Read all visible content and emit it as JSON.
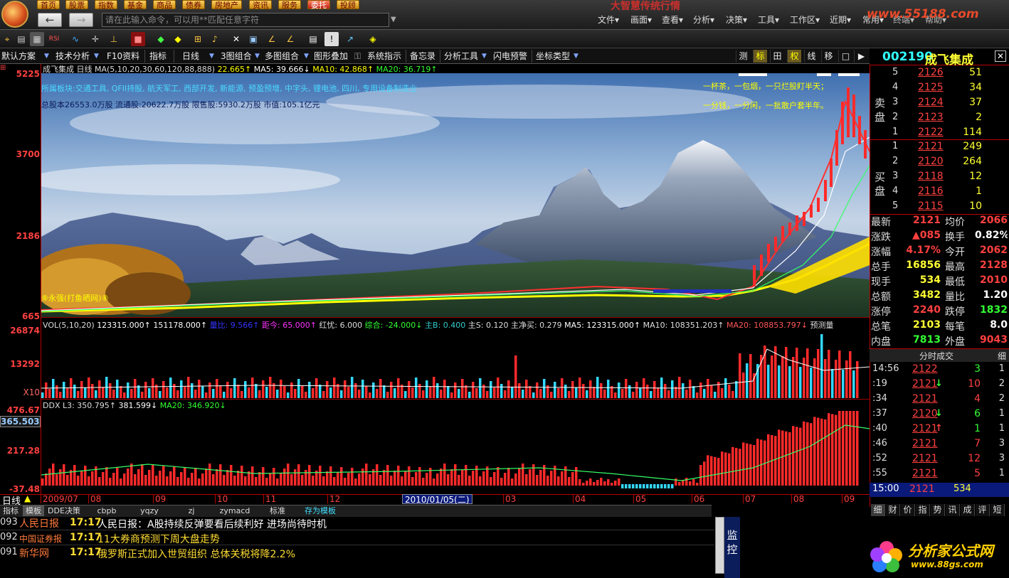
{
  "titlebar": {
    "markets": [
      "首页",
      "股票",
      "指数",
      "基金",
      "商品",
      "债券",
      "房地产",
      "资讯",
      "服务",
      "委托",
      "投顾"
    ],
    "back_icon": "←",
    "fwd_icon": "→",
    "command_placeholder": "请在此输入命令，可以用**匹配任意字符",
    "app_title": "大智慧传统行情",
    "menus": [
      "文件▾",
      "画面▾",
      "查看▾",
      "分析▾",
      "决策▾",
      "工具▾",
      "工作区▾",
      "近期▾",
      "常用▾",
      "终端▾",
      "帮助▾"
    ],
    "site_watermark": "www.55188.com"
  },
  "toolbar2": {
    "scheme": "默认方案",
    "items": [
      "技术分析",
      "F10资料",
      "指标",
      "日线",
      "3图组合",
      "多图组合",
      "图形叠加",
      "系统指示",
      "备忘录",
      "分析工具",
      "闪电预警",
      "坐标类型"
    ],
    "right": [
      "测",
      "标",
      "田",
      "权",
      "线",
      "移",
      "□",
      "▶"
    ]
  },
  "stock": {
    "code": "002190",
    "name": "成飞集成",
    "header_text": "成飞集成 日线",
    "ma_text": "MA(5,10,20,30,60,120,88,888)",
    "ma_value": "22.665↑",
    "ma5": "MA5: 39.666↓",
    "ma10": "MA10: 42.868↑",
    "ma20": "MA20: 36.719↑",
    "concepts": "所属板块:交通工具, QFII持股, 航天军工, 西部开发, 新能源, 预盈预增, 中字头, 锂电池, 四川, 专用设备制造业",
    "shares": "总股本26553.0万股 流通股:20622.7万股 限售股:5930.2万股 市值:105.1亿元",
    "poem1": "一杯茶，一包烟，一只烂股盯半天；",
    "poem2": "一分钱，一分闲，一批散户套半年。",
    "author": "⑧永强(打鱼晒网)⑧",
    "y_labels": [
      "5225",
      "3700",
      "2186",
      "665"
    ]
  },
  "volume": {
    "header": [
      "VOL(5,10,20)",
      "123315.000↑",
      "151178.000↑",
      "量比: 9.566↑",
      "距今: 65.000↑",
      "红忧: 6.000",
      "综合: -24.000↓",
      "主B: 0.400",
      "主S: 0.120",
      "主净买: 0.279",
      "MA5: 123315.000↑",
      "MA10: 108351.203↑",
      "MA20: 108853.797↓",
      "预测量"
    ],
    "y_labels": [
      "26874",
      "13292",
      "X10"
    ]
  },
  "ddx": {
    "header": [
      "DDX L3: 350.795↑",
      "381.599↓",
      "MA20: 346.920↓"
    ],
    "y_labels": [
      "476.67",
      "365.503",
      "217.28",
      "-37.48"
    ]
  },
  "xaxis": {
    "period": "日线",
    "labels": [
      "2009/07",
      "08",
      "09",
      "10",
      "11",
      "12",
      "2010/01/05(二)",
      "03",
      "04",
      "05",
      "06",
      "07",
      "08",
      "09"
    ]
  },
  "orderbook": {
    "sell_label": "卖 盘",
    "buy_label": "买 盘",
    "sell": [
      {
        "lvl": "5",
        "price": "2126",
        "vol": "51"
      },
      {
        "lvl": "4",
        "price": "2125",
        "vol": "34"
      },
      {
        "lvl": "3",
        "price": "2124",
        "vol": "37"
      },
      {
        "lvl": "2",
        "price": "2123",
        "vol": "2"
      },
      {
        "lvl": "1",
        "price": "2122",
        "vol": "114"
      }
    ],
    "buy": [
      {
        "lvl": "1",
        "price": "2121",
        "vol": "249"
      },
      {
        "lvl": "2",
        "price": "2120",
        "vol": "264"
      },
      {
        "lvl": "3",
        "price": "2118",
        "vol": "12"
      },
      {
        "lvl": "4",
        "price": "2116",
        "vol": "1"
      },
      {
        "lvl": "5",
        "price": "2115",
        "vol": "10"
      }
    ]
  },
  "quote": [
    {
      "l1": "最新",
      "v1": "2121",
      "l2": "均价",
      "v2": "2066"
    },
    {
      "l1": "涨跌",
      "v1": "▲085",
      "l2": "换手",
      "v2": "0.82%"
    },
    {
      "l1": "涨幅",
      "v1": "4.17%",
      "l2": "今开",
      "v2": "2062"
    },
    {
      "l1": "总手",
      "v1": "16856",
      "l2": "最高",
      "v2": "2128"
    },
    {
      "l1": "现手",
      "v1": "534",
      "l2": "最低",
      "v2": "2010"
    },
    {
      "l1": "总额",
      "v1": "3482",
      "l2": "量比",
      "v2": "1.20"
    },
    {
      "l1": "涨停",
      "v1": "2240",
      "l2": "跌停",
      "v2": "1832"
    },
    {
      "l1": "总笔",
      "v1": "2103",
      "l2": "每笔",
      "v2": "8.0"
    },
    {
      "l1": "内盘",
      "v1": "7813",
      "l2": "外盘",
      "v2": "9043"
    }
  ],
  "ticks": {
    "title": "分时成交",
    "right_tab": "细",
    "rows": [
      {
        "t": "14:56",
        "p": "2122",
        "a": "",
        "v": "3",
        "n": "1"
      },
      {
        "t": ":19",
        "p": "2121",
        "a": "↓",
        "v": "10",
        "n": "2"
      },
      {
        "t": ":34",
        "p": "2121",
        "a": "",
        "v": "4",
        "n": "2"
      },
      {
        "t": ":37",
        "p": "2120",
        "a": "↓",
        "v": "6",
        "n": "1"
      },
      {
        "t": ":40",
        "p": "2121",
        "a": "↑",
        "v": "1",
        "n": "1"
      },
      {
        "t": ":46",
        "p": "2121",
        "a": "",
        "v": "7",
        "n": "3"
      },
      {
        "t": ":52",
        "p": "2121",
        "a": "",
        "v": "12",
        "n": "3"
      },
      {
        "t": ":55",
        "p": "2121",
        "a": "",
        "v": "5",
        "n": "1"
      }
    ],
    "last": {
      "t": "15:00",
      "p": "2121",
      "v": "534"
    },
    "tabs": [
      "细",
      "财",
      "价",
      "指",
      "势",
      "讯",
      "成",
      "评",
      "短"
    ]
  },
  "bottom_tabs": [
    "指标",
    "模板",
    "DDE决策",
    "cbpb",
    "yqzy",
    "zj",
    "zymacd",
    "标准",
    "存为模板"
  ],
  "news": [
    {
      "id": "093",
      "src": "人民日报",
      "time": "17:17",
      "text": "人民日报：A股持续反弹要看后续利好 进场尚待时机"
    },
    {
      "id": "092",
      "src": "中国证券报",
      "time": "17:17",
      "text": "11大券商预测下周大盘走势"
    },
    {
      "id": "091",
      "src": "新华网",
      "time": "17:17",
      "text": "俄罗斯正式加入世贸组织 总体关税将降2.2%"
    }
  ],
  "monitor_label": "监控",
  "brand": {
    "name": "分析家公式网",
    "url": "www.88gs.com"
  },
  "colors": {
    "up": "#ff3b3b",
    "down": "#33ffff",
    "accent_yellow": "#ffff33",
    "panel_border": "#b00000",
    "code_cyan": "#33ffff"
  }
}
